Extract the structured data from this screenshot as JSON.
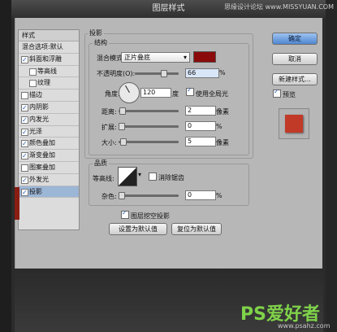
{
  "window": {
    "title": "图层样式",
    "watermark_top": "思缘设计论坛 www.MISSYUAN.COM"
  },
  "styles_panel": {
    "header": "样式",
    "items": [
      {
        "label": "混合选项:默认",
        "checkbox": false,
        "sub": false,
        "checked": false,
        "active": false
      },
      {
        "label": "斜面和浮雕",
        "checkbox": true,
        "sub": false,
        "checked": true,
        "active": false
      },
      {
        "label": "等高线",
        "checkbox": true,
        "sub": true,
        "checked": false,
        "active": false
      },
      {
        "label": "纹理",
        "checkbox": true,
        "sub": true,
        "checked": false,
        "active": false
      },
      {
        "label": "描边",
        "checkbox": true,
        "sub": false,
        "checked": false,
        "active": false
      },
      {
        "label": "内阴影",
        "checkbox": true,
        "sub": false,
        "checked": true,
        "active": false
      },
      {
        "label": "内发光",
        "checkbox": true,
        "sub": false,
        "checked": true,
        "active": false
      },
      {
        "label": "光泽",
        "checkbox": true,
        "sub": false,
        "checked": true,
        "active": false
      },
      {
        "label": "颜色叠加",
        "checkbox": true,
        "sub": false,
        "checked": true,
        "active": false
      },
      {
        "label": "渐变叠加",
        "checkbox": true,
        "sub": false,
        "checked": true,
        "active": false
      },
      {
        "label": "图案叠加",
        "checkbox": true,
        "sub": false,
        "checked": false,
        "active": false
      },
      {
        "label": "外发光",
        "checkbox": true,
        "sub": false,
        "checked": true,
        "active": false
      },
      {
        "label": "投影",
        "checkbox": true,
        "sub": false,
        "checked": true,
        "active": true
      }
    ]
  },
  "drop_shadow": {
    "section_title": "投影",
    "structure_title": "结构",
    "blend_mode_label": "混合模式:",
    "blend_mode_value": "正片叠底",
    "shadow_color": "#8b0a0a",
    "opacity_label": "不透明度(O):",
    "opacity_value": "66",
    "opacity_level": 0.66,
    "opacity_unit": "%",
    "angle_label": "角度:",
    "angle_value": "120",
    "angle_unit": "度",
    "global_light_label": "使用全局光",
    "global_light_checked": true,
    "distance_label": "距离:",
    "distance_value": "2",
    "distance_unit": "像素",
    "spread_label": "扩展:",
    "spread_value": "0",
    "spread_unit": "%",
    "size_label": "大小:",
    "size_value": "5",
    "size_unit": "像素",
    "quality_title": "品质",
    "contour_label": "等高线:",
    "antialias_label": "消除锯齿",
    "antialias_checked": false,
    "noise_label": "杂色:",
    "noise_value": "0",
    "noise_unit": "%",
    "knockout_label": "图层挖空投影",
    "knockout_checked": true,
    "set_default_label": "设置为默认值",
    "reset_default_label": "复位为默认值"
  },
  "buttons": {
    "ok": "确定",
    "cancel": "取消",
    "new_style": "新建样式...",
    "preview_label": "预览",
    "preview_checked": true
  },
  "watermark_bottom": {
    "logo": "PS爱好者",
    "url": "www.psahz.com"
  }
}
